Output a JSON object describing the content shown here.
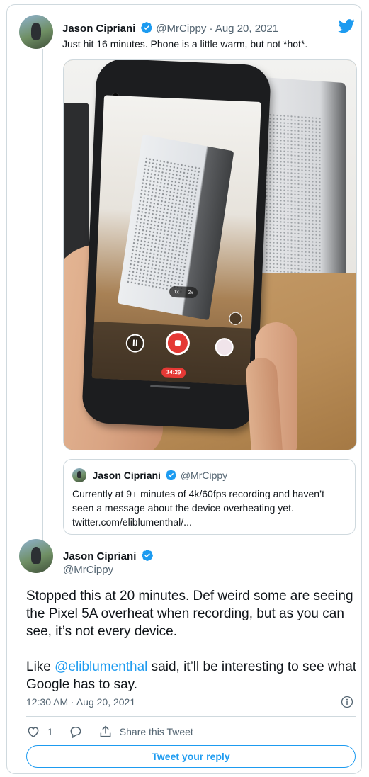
{
  "reply_tweet": {
    "author_name": "Jason Cipriani",
    "handle_and_date": "@MrCippy · Aug 20, 2021",
    "text": "Just hit 16 minutes. Phone is a little warm, but not *hot*."
  },
  "photo_overlay": {
    "zoom_1x": "1x",
    "zoom_2x": "2x",
    "recording_timer": "14:29"
  },
  "quoted_tweet": {
    "author_name": "Jason Cipriani",
    "handle": "@MrCippy",
    "text": "Currently at 9+ minutes of 4k/60fps recording and haven’t seen a message about the device overheating yet.",
    "link": "twitter.com/eliblumenthal/..."
  },
  "main_tweet": {
    "author_name": "Jason Cipriani",
    "handle": "@MrCippy",
    "paragraph1": "Stopped this at 20 minutes. Def weird some are seeing the Pixel 5A overheat when recording, but as you can see, it’s not every device.",
    "paragraph2_prefix": "Like ",
    "mention": "@eliblumenthal",
    "paragraph2_suffix": " said, it’ll be interesting to see what Google has to say.",
    "timestamp": "12:30 AM · Aug 20, 2021"
  },
  "actions": {
    "like_count": "1",
    "share_label": "Share this Tweet",
    "reply_button": "Tweet your reply"
  },
  "icons": {
    "verified": "verified-badge-icon",
    "logo": "twitter-bird-icon",
    "like": "heart-icon",
    "reply": "comment-icon",
    "share": "share-icon",
    "info": "info-icon"
  },
  "colors": {
    "accent": "#1d9bf0",
    "text": "#0f1419",
    "secondary": "#536471",
    "border": "#cfd9de",
    "record_red": "#e53935"
  }
}
